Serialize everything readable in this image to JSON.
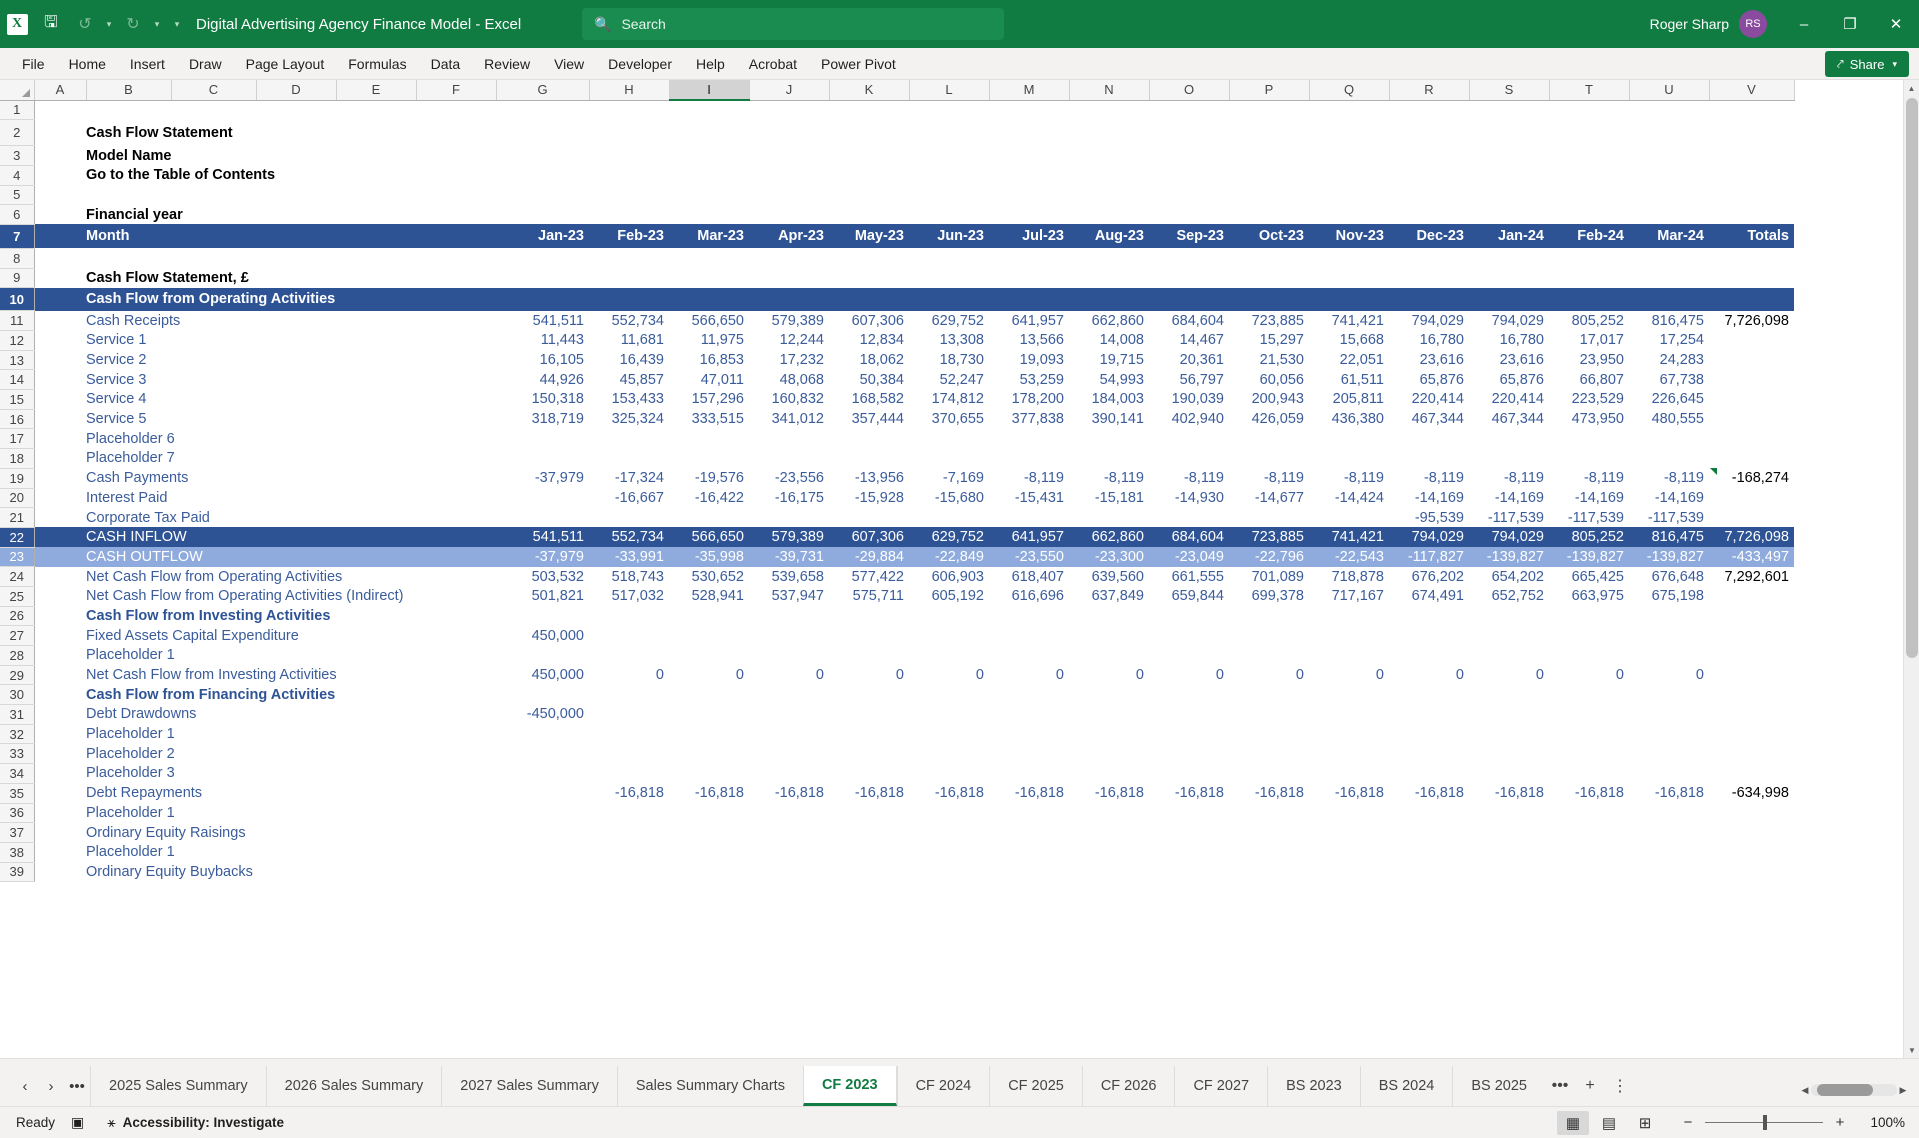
{
  "titlebar": {
    "app_icon": "excel-icon",
    "doc_title": "Digital Advertising Agency Finance Model  -  Excel",
    "save_icon": "save-icon",
    "undo_icon": "undo-icon",
    "redo_icon": "redo-icon",
    "customize_icon": "customize-quick-access-icon",
    "search_placeholder": "Search",
    "search_icon": "search-icon",
    "user_name": "Roger Sharp",
    "avatar_initials": "RS",
    "minimize": "–",
    "restore": "❐",
    "close": "✕"
  },
  "ribbon": {
    "tabs": [
      "File",
      "Home",
      "Insert",
      "Draw",
      "Page Layout",
      "Formulas",
      "Data",
      "Review",
      "View",
      "Developer",
      "Help",
      "Acrobat",
      "Power Pivot"
    ],
    "share_label": "Share",
    "share_icon": "share-icon"
  },
  "grid": {
    "columns": [
      "A",
      "B",
      "C",
      "D",
      "E",
      "F",
      "G",
      "H",
      "I",
      "J",
      "K",
      "L",
      "M",
      "N",
      "O",
      "P",
      "Q",
      "R",
      "S",
      "T",
      "U",
      "V"
    ],
    "selected_column": "I",
    "row_numbers": [
      "1",
      "2",
      "3",
      "4",
      "5",
      "6",
      "7",
      "8",
      "9",
      "10",
      "11",
      "12",
      "13",
      "14",
      "15",
      "16",
      "17",
      "18",
      "19",
      "20",
      "21",
      "22",
      "23",
      "24",
      "25",
      "26",
      "27",
      "28",
      "29",
      "30",
      "31",
      "32",
      "33",
      "34",
      "35",
      "36",
      "37",
      "38",
      "39"
    ],
    "month_headers": [
      "Jan-23",
      "Feb-23",
      "Mar-23",
      "Apr-23",
      "May-23",
      "Jun-23",
      "Jul-23",
      "Aug-23",
      "Sep-23",
      "Oct-23",
      "Nov-23",
      "Dec-23",
      "Jan-24",
      "Feb-24",
      "Mar-24"
    ],
    "totals_header": "Totals",
    "title": "Cash Flow Statement",
    "model_name": "Model Name",
    "toc_link": "Go to the Table of Contents",
    "financial_year_label": "Financial year",
    "month_label": "Month",
    "statement_label": "Cash Flow Statement, £",
    "operating_band": "Cash Flow from Operating Activities",
    "comment_cell_row": 19,
    "rows": [
      {
        "n": "11",
        "label": "Cash Receipts",
        "indent": 1,
        "style": "normal",
        "values": [
          "541,511",
          "552,734",
          "566,650",
          "579,389",
          "607,306",
          "629,752",
          "641,957",
          "662,860",
          "684,604",
          "723,885",
          "741,421",
          "794,029",
          "794,029",
          "805,252",
          "816,475"
        ],
        "total": "7,726,098"
      },
      {
        "n": "12",
        "label": "Service 1",
        "indent": 2,
        "style": "normal",
        "values": [
          "11,443",
          "11,681",
          "11,975",
          "12,244",
          "12,834",
          "13,308",
          "13,566",
          "14,008",
          "14,467",
          "15,297",
          "15,668",
          "16,780",
          "16,780",
          "17,017",
          "17,254"
        ],
        "total": ""
      },
      {
        "n": "13",
        "label": "Service 2",
        "indent": 2,
        "style": "normal",
        "values": [
          "16,105",
          "16,439",
          "16,853",
          "17,232",
          "18,062",
          "18,730",
          "19,093",
          "19,715",
          "20,361",
          "21,530",
          "22,051",
          "23,616",
          "23,616",
          "23,950",
          "24,283"
        ],
        "total": ""
      },
      {
        "n": "14",
        "label": "Service 3",
        "indent": 2,
        "style": "normal",
        "values": [
          "44,926",
          "45,857",
          "47,011",
          "48,068",
          "50,384",
          "52,247",
          "53,259",
          "54,993",
          "56,797",
          "60,056",
          "61,511",
          "65,876",
          "65,876",
          "66,807",
          "67,738"
        ],
        "total": ""
      },
      {
        "n": "15",
        "label": "Service 4",
        "indent": 2,
        "style": "normal",
        "values": [
          "150,318",
          "153,433",
          "157,296",
          "160,832",
          "168,582",
          "174,812",
          "178,200",
          "184,003",
          "190,039",
          "200,943",
          "205,811",
          "220,414",
          "220,414",
          "223,529",
          "226,645"
        ],
        "total": ""
      },
      {
        "n": "16",
        "label": "Service 5",
        "indent": 2,
        "style": "normal",
        "values": [
          "318,719",
          "325,324",
          "333,515",
          "341,012",
          "357,444",
          "370,655",
          "377,838",
          "390,141",
          "402,940",
          "426,059",
          "436,380",
          "467,344",
          "467,344",
          "473,950",
          "480,555"
        ],
        "total": ""
      },
      {
        "n": "17",
        "label": "Placeholder 6",
        "indent": 3,
        "style": "normal",
        "values": [
          "",
          "",
          "",
          "",
          "",
          "",
          "",
          "",
          "",
          "",
          "",
          "",
          "",
          "",
          ""
        ],
        "total": ""
      },
      {
        "n": "18",
        "label": "Placeholder 7",
        "indent": 3,
        "style": "normal",
        "values": [
          "",
          "",
          "",
          "",
          "",
          "",
          "",
          "",
          "",
          "",
          "",
          "",
          "",
          "",
          ""
        ],
        "total": ""
      },
      {
        "n": "19",
        "label": "Cash Payments",
        "indent": 1,
        "style": "normal",
        "values": [
          "-37,979",
          "-17,324",
          "-19,576",
          "-23,556",
          "-13,956",
          "-7,169",
          "-8,119",
          "-8,119",
          "-8,119",
          "-8,119",
          "-8,119",
          "-8,119",
          "-8,119",
          "-8,119",
          "-8,119"
        ],
        "total": "-168,274"
      },
      {
        "n": "20",
        "label": "Interest Paid",
        "indent": 1,
        "style": "normal",
        "values": [
          "",
          "-16,667",
          "-16,422",
          "-16,175",
          "-15,928",
          "-15,680",
          "-15,431",
          "-15,181",
          "-14,930",
          "-14,677",
          "-14,424",
          "-14,169",
          "-14,169",
          "-14,169",
          "-14,169"
        ],
        "total": ""
      },
      {
        "n": "21",
        "label": "Corporate Tax Paid",
        "indent": 1,
        "style": "normal",
        "values": [
          "",
          "",
          "",
          "",
          "",
          "",
          "",
          "",
          "",
          "",
          "",
          "-95,539",
          "-117,539",
          "-117,539",
          "-117,539"
        ],
        "total": ""
      },
      {
        "n": "22",
        "label": "CASH INFLOW",
        "indent": 1,
        "style": "inflow",
        "values": [
          "541,511",
          "552,734",
          "566,650",
          "579,389",
          "607,306",
          "629,752",
          "641,957",
          "662,860",
          "684,604",
          "723,885",
          "741,421",
          "794,029",
          "794,029",
          "805,252",
          "816,475"
        ],
        "total": "7,726,098"
      },
      {
        "n": "23",
        "label": "CASH OUTFLOW",
        "indent": 1,
        "style": "outflow",
        "values": [
          "-37,979",
          "-33,991",
          "-35,998",
          "-39,731",
          "-29,884",
          "-22,849",
          "-23,550",
          "-23,300",
          "-23,049",
          "-22,796",
          "-22,543",
          "-117,827",
          "-139,827",
          "-139,827",
          "-139,827"
        ],
        "total": "-433,497"
      },
      {
        "n": "24",
        "label": "Net Cash Flow from Operating Activities",
        "indent": 0,
        "style": "normal",
        "values": [
          "503,532",
          "518,743",
          "530,652",
          "539,658",
          "577,422",
          "606,903",
          "618,407",
          "639,560",
          "661,555",
          "701,089",
          "718,878",
          "676,202",
          "654,202",
          "665,425",
          "676,648"
        ],
        "total": "7,292,601"
      },
      {
        "n": "25",
        "label": "Net Cash Flow from Operating Activities (Indirect)",
        "indent": 0,
        "style": "normal",
        "values": [
          "501,821",
          "517,032",
          "528,941",
          "537,947",
          "575,711",
          "605,192",
          "616,696",
          "637,849",
          "659,844",
          "699,378",
          "717,167",
          "674,491",
          "652,752",
          "663,975",
          "675,198"
        ],
        "total": ""
      },
      {
        "n": "26",
        "label": "Cash Flow from Investing Activities",
        "indent": 0,
        "style": "secthdr",
        "values": [
          "",
          "",
          "",
          "",
          "",
          "",
          "",
          "",
          "",
          "",
          "",
          "",
          "",
          "",
          ""
        ],
        "total": ""
      },
      {
        "n": "27",
        "label": "Fixed Assets Capital Expenditure",
        "indent": 1,
        "style": "normal",
        "values": [
          "450,000",
          "",
          "",
          "",
          "",
          "",
          "",
          "",
          "",
          "",
          "",
          "",
          "",
          "",
          ""
        ],
        "total": ""
      },
      {
        "n": "28",
        "label": "Placeholder 1",
        "indent": 3,
        "style": "normal",
        "values": [
          "",
          "",
          "",
          "",
          "",
          "",
          "",
          "",
          "",
          "",
          "",
          "",
          "",
          "",
          ""
        ],
        "total": ""
      },
      {
        "n": "29",
        "label": "Net Cash Flow from Investing Activities",
        "indent": 1,
        "style": "normal",
        "values": [
          "450,000",
          "0",
          "0",
          "0",
          "0",
          "0",
          "0",
          "0",
          "0",
          "0",
          "0",
          "0",
          "0",
          "0",
          "0"
        ],
        "total": ""
      },
      {
        "n": "30",
        "label": "Cash Flow from Financing Activities",
        "indent": 0,
        "style": "secthdr",
        "values": [
          "",
          "",
          "",
          "",
          "",
          "",
          "",
          "",
          "",
          "",
          "",
          "",
          "",
          "",
          ""
        ],
        "total": ""
      },
      {
        "n": "31",
        "label": "Debt Drawdowns",
        "indent": 1,
        "style": "normal",
        "values": [
          "-450,000",
          "",
          "",
          "",
          "",
          "",
          "",
          "",
          "",
          "",
          "",
          "",
          "",
          "",
          ""
        ],
        "total": ""
      },
      {
        "n": "32",
        "label": "Placeholder 1",
        "indent": 3,
        "style": "normal",
        "values": [
          "",
          "",
          "",
          "",
          "",
          "",
          "",
          "",
          "",
          "",
          "",
          "",
          "",
          "",
          ""
        ],
        "total": ""
      },
      {
        "n": "33",
        "label": "Placeholder 2",
        "indent": 3,
        "style": "normal",
        "values": [
          "",
          "",
          "",
          "",
          "",
          "",
          "",
          "",
          "",
          "",
          "",
          "",
          "",
          "",
          ""
        ],
        "total": ""
      },
      {
        "n": "34",
        "label": "Placeholder 3",
        "indent": 3,
        "style": "normal",
        "values": [
          "",
          "",
          "",
          "",
          "",
          "",
          "",
          "",
          "",
          "",
          "",
          "",
          "",
          "",
          ""
        ],
        "total": ""
      },
      {
        "n": "35",
        "label": "Debt Repayments",
        "indent": 1,
        "style": "normal",
        "values": [
          "",
          "-16,818",
          "-16,818",
          "-16,818",
          "-16,818",
          "-16,818",
          "-16,818",
          "-16,818",
          "-16,818",
          "-16,818",
          "-16,818",
          "-16,818",
          "-16,818",
          "-16,818",
          "-16,818"
        ],
        "total": "-634,998"
      },
      {
        "n": "36",
        "label": "Placeholder 1",
        "indent": 3,
        "style": "normal",
        "values": [
          "",
          "",
          "",
          "",
          "",
          "",
          "",
          "",
          "",
          "",
          "",
          "",
          "",
          "",
          ""
        ],
        "total": ""
      },
      {
        "n": "37",
        "label": "Ordinary Equity Raisings",
        "indent": 1,
        "style": "normal",
        "values": [
          "",
          "",
          "",
          "",
          "",
          "",
          "",
          "",
          "",
          "",
          "",
          "",
          "",
          "",
          ""
        ],
        "total": ""
      },
      {
        "n": "38",
        "label": "Placeholder 1",
        "indent": 3,
        "style": "normal",
        "values": [
          "",
          "",
          "",
          "",
          "",
          "",
          "",
          "",
          "",
          "",
          "",
          "",
          "",
          "",
          ""
        ],
        "total": ""
      },
      {
        "n": "39",
        "label": "Ordinary Equity Buybacks",
        "indent": 1,
        "style": "normal",
        "values": [
          "",
          "",
          "",
          "",
          "",
          "",
          "",
          "",
          "",
          "",
          "",
          "",
          "",
          "",
          ""
        ],
        "total": ""
      }
    ]
  },
  "sheettabs": {
    "prev_icon": "previous-sheet-icon",
    "next_icon": "next-sheet-icon",
    "more_icon": "all-sheets-icon",
    "tabs": [
      "2025 Sales Summary",
      "2026 Sales Summary",
      "2027 Sales Summary",
      "Sales Summary Charts",
      "CF 2023",
      "CF 2024",
      "CF 2025",
      "CF 2026",
      "CF 2027",
      "BS 2023",
      "BS 2024",
      "BS 2025"
    ],
    "active_tab": "CF 2023",
    "overflow_icon": "more-sheets-icon",
    "add_icon": "+",
    "options_icon": "sheet-options-icon"
  },
  "statusbar": {
    "mode": "Ready",
    "record_macro_icon": "record-macro-icon",
    "accessibility_icon": "accessibility-icon",
    "accessibility_text": "Accessibility: Investigate",
    "view_normal_icon": "normal-view-icon",
    "view_pagelayout_icon": "page-layout-view-icon",
    "view_pagebreak_icon": "page-break-preview-icon",
    "zoom_out": "−",
    "zoom_in": "+",
    "zoom_level": "100%"
  }
}
